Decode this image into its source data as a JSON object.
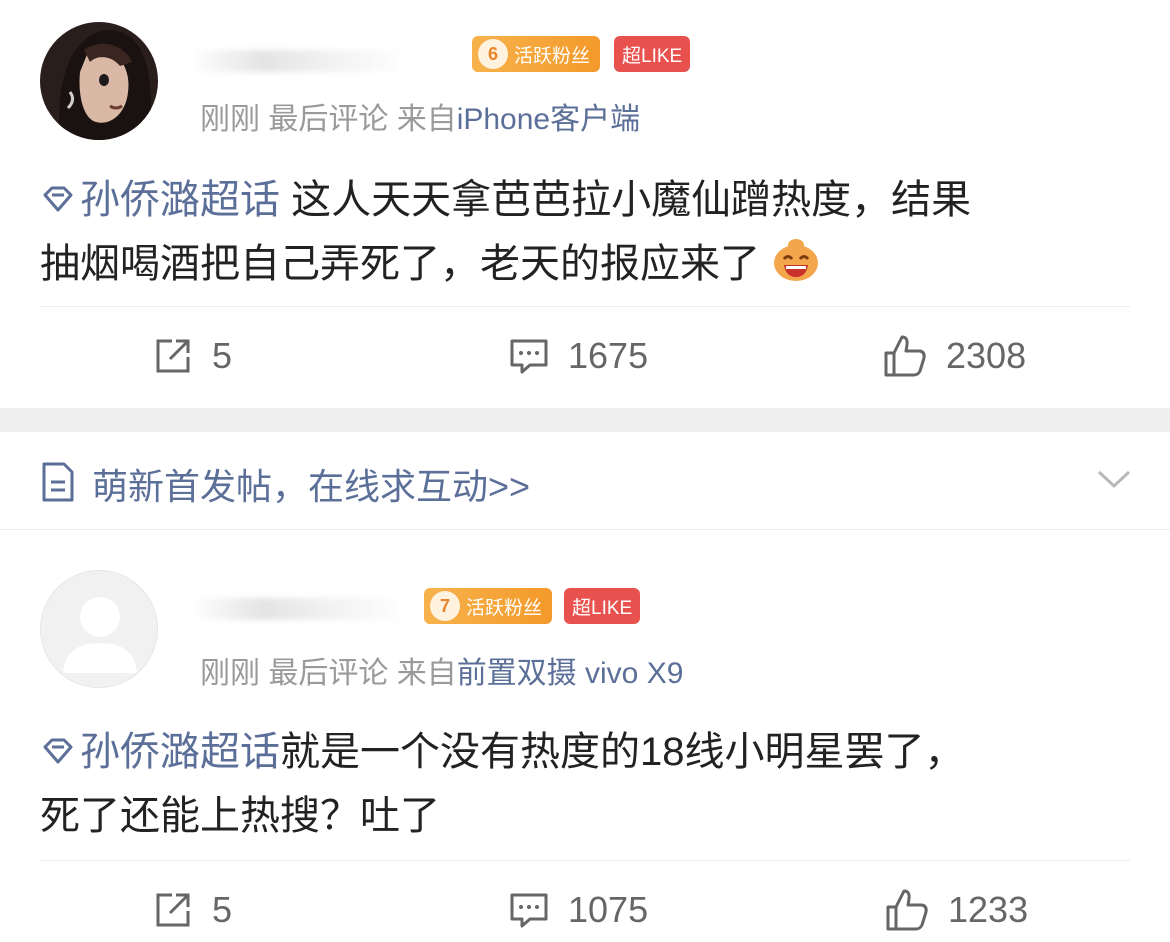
{
  "posts": [
    {
      "fan_level": "6",
      "fan_badge": "活跃粉丝",
      "like_badge": "超LIKE",
      "time": "刚刚",
      "status": "最后评论",
      "from_label": "来自",
      "source": "iPhone客户端",
      "topic": "孙侨潞超话",
      "content_line1": " 这人天天拿芭芭拉小魔仙蹭热度，结果",
      "content_line2": "抽烟喝酒把自己弄死了，老天的报应来了",
      "reposts": "5",
      "comments": "1675",
      "likes": "2308",
      "icons": {
        "topic": "diamond-topic-icon",
        "emoji": "laughing-emoji-icon",
        "repost": "repost-icon",
        "comment": "comment-icon",
        "like": "thumbs-up-icon"
      }
    },
    {
      "fan_level": "7",
      "fan_badge": "活跃粉丝",
      "like_badge": "超LIKE",
      "time": "刚刚",
      "status": "最后评论",
      "from_label": "来自",
      "source": "前置双摄 vivo X9",
      "topic": "孙侨潞超话",
      "content_line1": "就是一个没有热度的18线小明星罢了，",
      "content_line2": "死了还能上热搜？吐了",
      "reposts": "5",
      "comments": "1075",
      "likes": "1233"
    }
  ],
  "notice": {
    "text": "萌新首发帖，在线求互动>>"
  },
  "colors": {
    "link": "#5b6f98",
    "meta": "#9a9a9a",
    "fan_badge": "#f39a2a",
    "like_badge": "#e9514e",
    "gap": "#efefef"
  }
}
